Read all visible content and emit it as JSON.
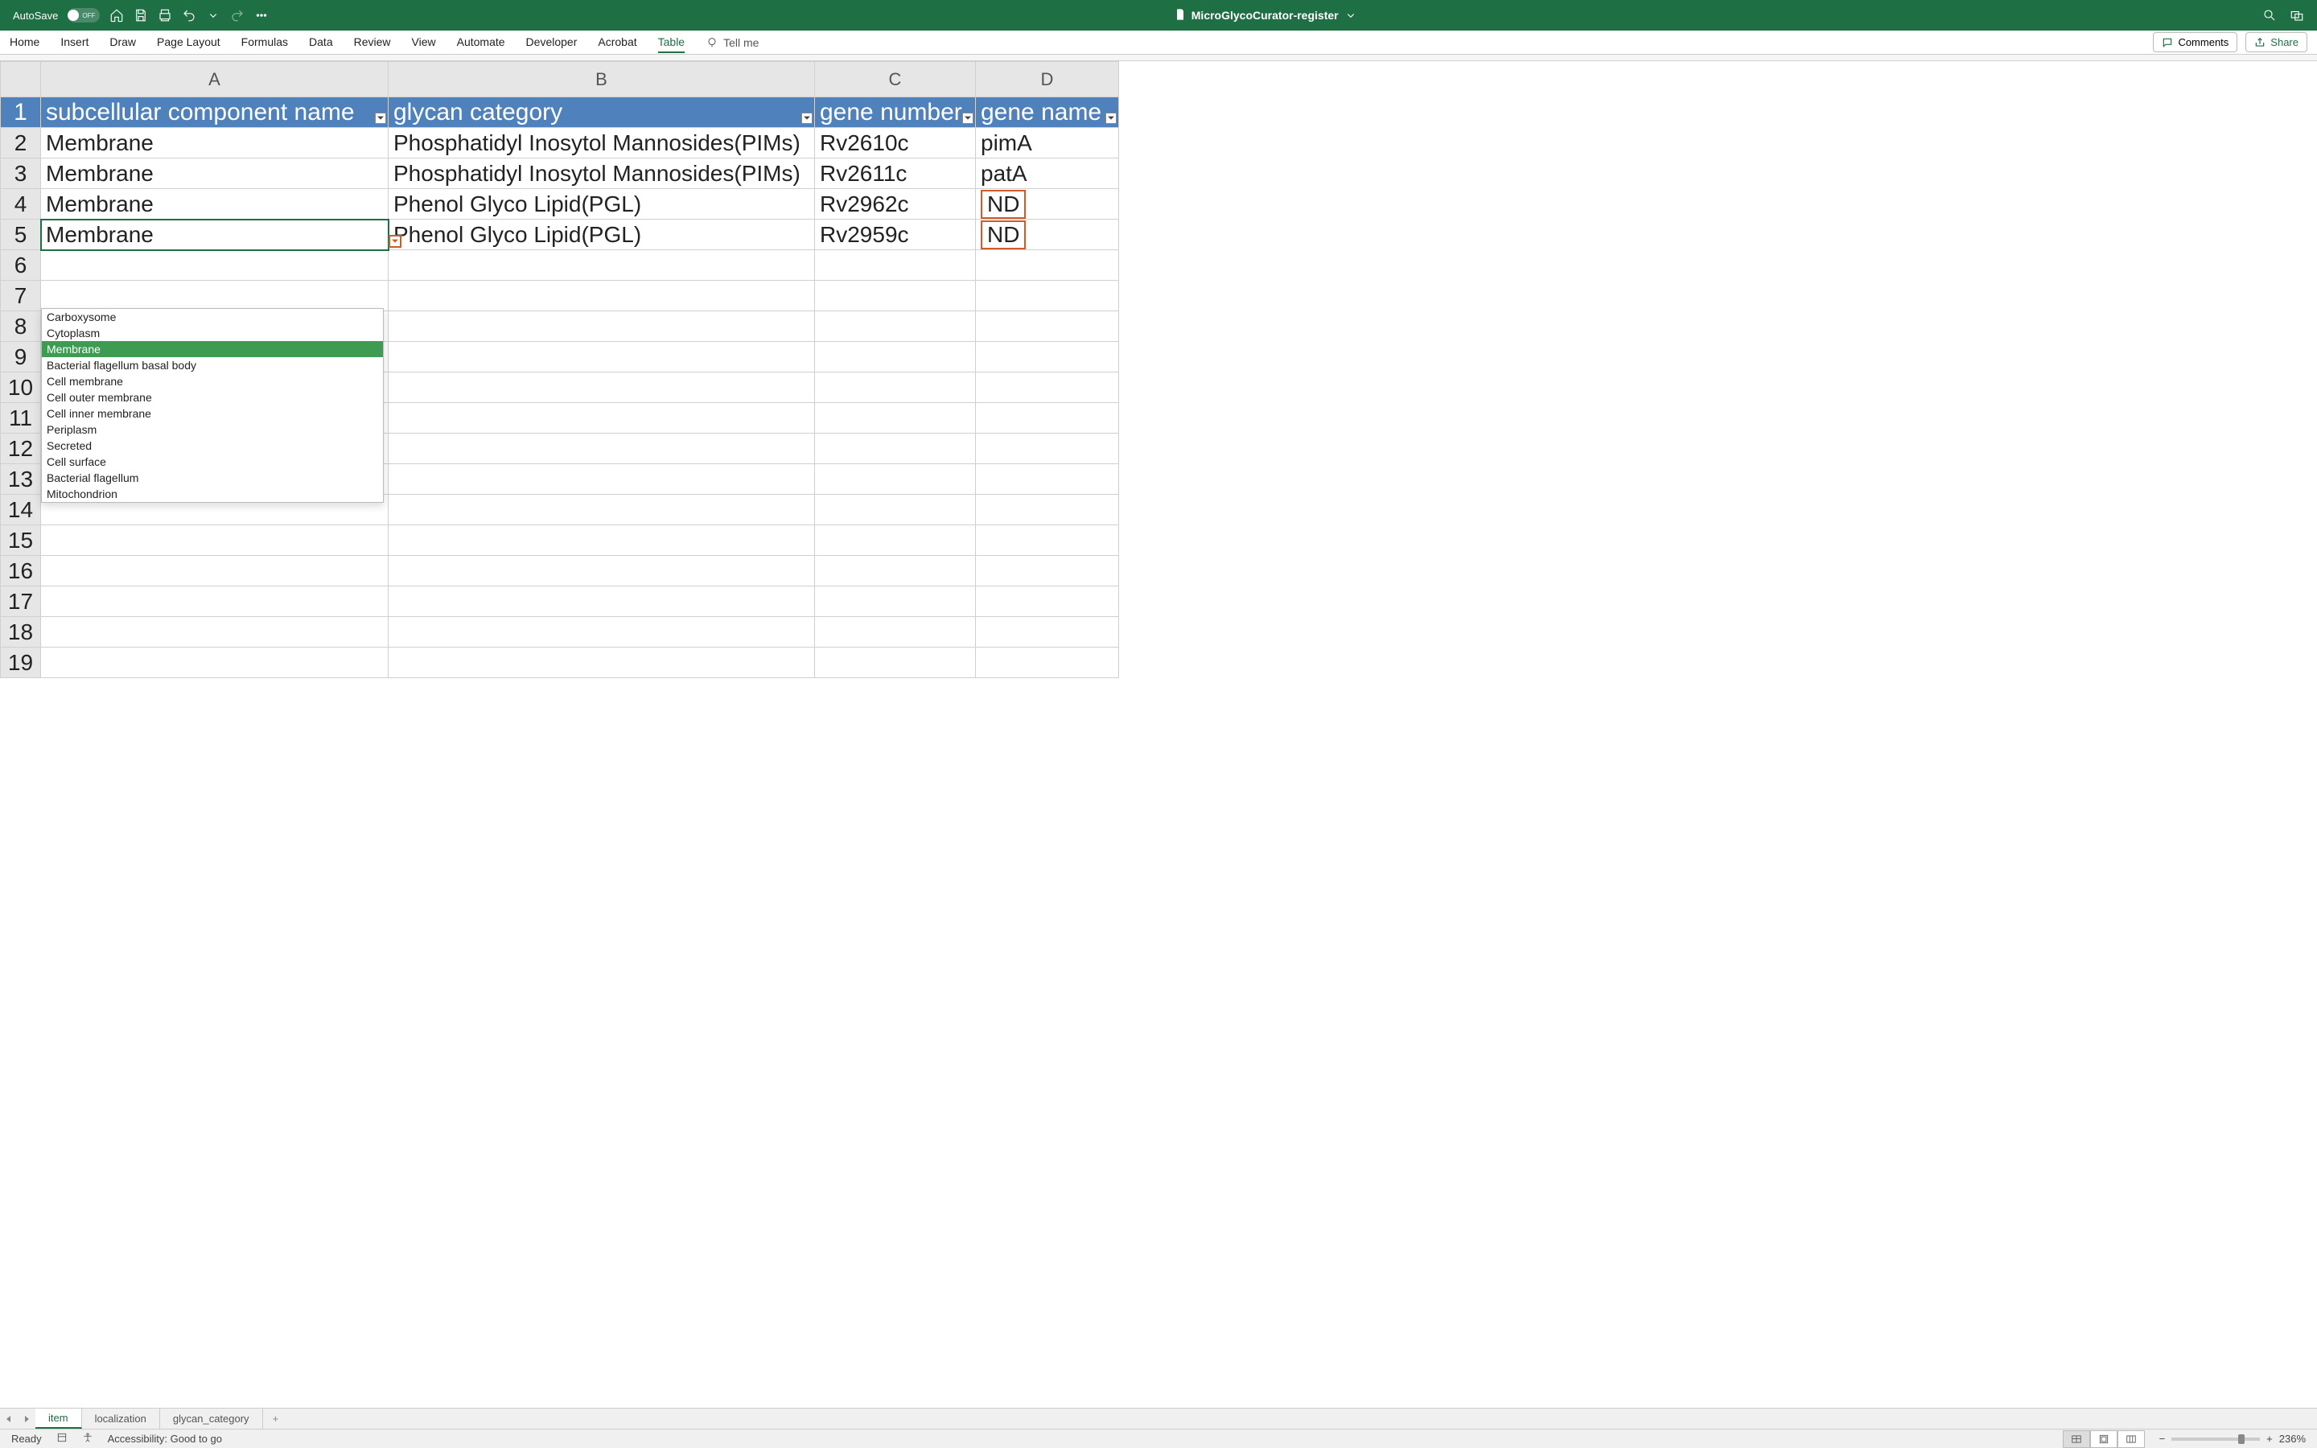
{
  "titlebar": {
    "autosave_label": "AutoSave",
    "autosave_state": "OFF",
    "doc_name": "MicroGlycoCurator-register"
  },
  "ribbon": {
    "tabs": [
      "Home",
      "Insert",
      "Draw",
      "Page Layout",
      "Formulas",
      "Data",
      "Review",
      "View",
      "Automate",
      "Developer",
      "Acrobat",
      "Table"
    ],
    "active_tab": "Table",
    "tellme": "Tell me",
    "comments": "Comments",
    "share": "Share"
  },
  "columns": [
    "A",
    "B",
    "C",
    "D"
  ],
  "row_numbers": [
    1,
    2,
    3,
    4,
    5,
    6,
    7,
    8,
    9,
    10,
    11,
    12,
    13,
    14,
    15,
    16,
    17,
    18,
    19
  ],
  "headers": {
    "A": "subcellular component name",
    "B": "glycan category",
    "C": "gene number",
    "D": "gene name"
  },
  "rows": [
    {
      "A": "Membrane",
      "B": "Phosphatidyl Inosytol Mannosides(PIMs)",
      "C": "Rv2610c",
      "D": "pimA"
    },
    {
      "A": "Membrane",
      "B": "Phosphatidyl Inosytol Mannosides(PIMs)",
      "C": "Rv2611c",
      "D": "patA"
    },
    {
      "A": "Membrane",
      "B": "Phenol Glyco Lipid(PGL)",
      "C": "Rv2962c",
      "D": "ND"
    },
    {
      "A": "Membrane",
      "B": "Phenol Glyco Lipid(PGL)",
      "C": "Rv2959c",
      "D": "ND"
    }
  ],
  "dropdown": {
    "options": [
      "Carboxysome",
      "Cytoplasm",
      "Membrane",
      "Bacterial flagellum basal body",
      "Cell membrane",
      "Cell outer membrane",
      "Cell inner membrane",
      "Periplasm",
      "Secreted",
      "Cell surface",
      "Bacterial flagellum",
      "Mitochondrion"
    ],
    "selected": "Membrane"
  },
  "sheets": {
    "tabs": [
      "item",
      "localization",
      "glycan_category"
    ],
    "active": "item"
  },
  "status": {
    "ready": "Ready",
    "accessibility": "Accessibility: Good to go",
    "zoom": "236%"
  }
}
